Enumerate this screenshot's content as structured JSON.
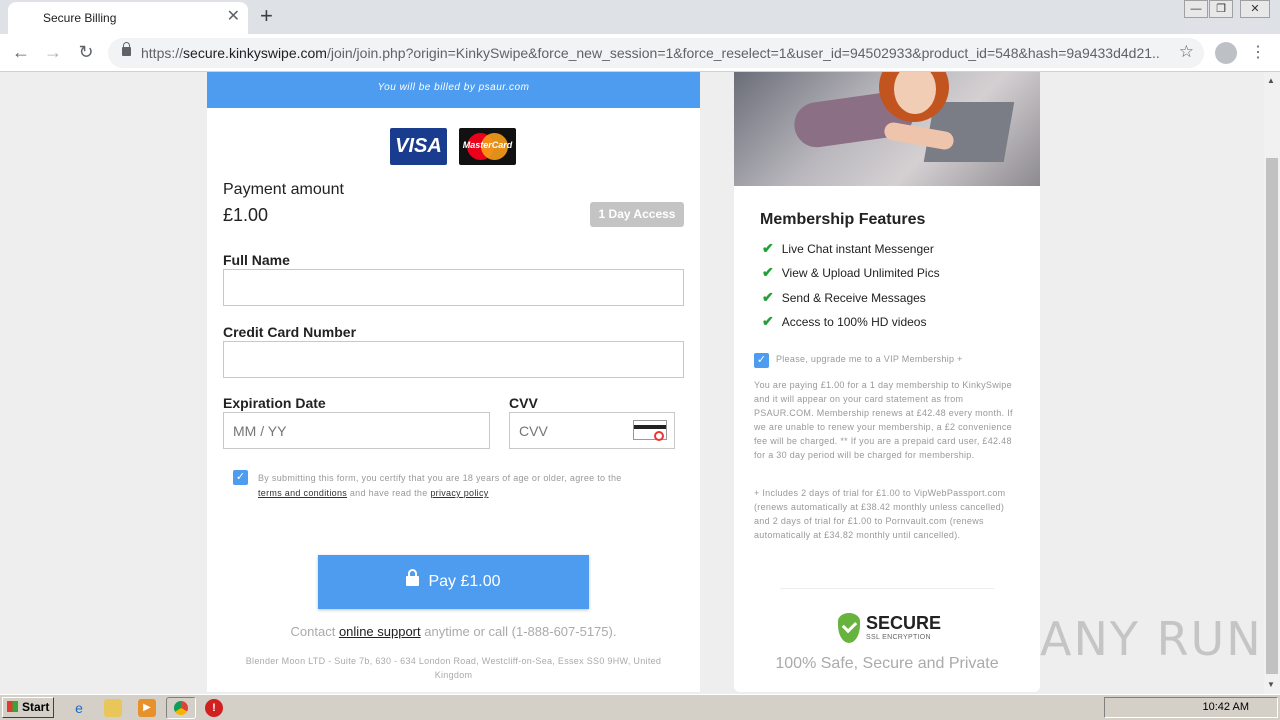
{
  "browser": {
    "tab_title": "Secure Billing",
    "tab_close": "✕",
    "new_tab": "+",
    "url_scheme": "https://",
    "url_host": "secure.kinkyswipe.com",
    "url_path": "/join/join.php?origin=KinkySwipe&force_new_session=1&force_reselect=1&user_id=94502933&product_id=548&hash=9a9433d4d21...",
    "back": "←",
    "forward": "→",
    "reload": "↻",
    "star": "☆",
    "menu": "⋮",
    "min": "—",
    "max": "❐",
    "close": "✕"
  },
  "left": {
    "billed_by": "You will be billed by psaur.com",
    "visa": "VISA",
    "mastercard": "MasterCard",
    "payment_label": "Payment amount",
    "payment_amount": "£1.00",
    "access_badge": "1 Day Access",
    "full_name_label": "Full Name",
    "full_name_value": "",
    "card_label": "Credit Card Number",
    "card_value": "",
    "exp_label": "Expiration Date",
    "exp_placeholder": "MM / YY",
    "cvv_label": "CVV",
    "cvv_placeholder": "CVV",
    "terms_prefix": "By submitting this form, you certify that you are 18 years of age or older, agree to the",
    "terms_link": "terms and conditions",
    "terms_mid": "and have read the",
    "privacy_link": "privacy policy",
    "pay_button": "Pay £1.00",
    "contact_prefix": "Contact",
    "contact_link": "online support",
    "contact_suffix": "anytime or call (1-888-607-5175).",
    "address": "Blender Moon LTD - Suite 7b, 630 - 634 London Road, Westcliff-on-Sea, Essex SS0 9HW, United Kingdom"
  },
  "right": {
    "features_title": "Membership Features",
    "features": [
      "Live Chat instant Messenger",
      "View & Upload Unlimited Pics",
      "Send & Receive Messages",
      "Access to 100% HD videos"
    ],
    "vip_label": "Please, upgrade me to a VIP Membership +",
    "note1": "You are paying £1.00 for a 1 day membership to KinkySwipe and it will appear on your card statement as from PSAUR.COM. Membership renews at £42.48 every month. If we are unable to renew your membership, a £2 convenience fee will be charged. ** If you are a prepaid card user, £42.48 for a 30 day period will be charged for membership.",
    "note2": "+ Includes 2 days of trial for £1.00 to VipWebPassport.com (renews automatically at £38.42 monthly unless cancelled) and 2 days of trial for £1.00 to Pornvault.com (renews automatically at £34.82 monthly until cancelled).",
    "secure_word": "SECURE",
    "ssl": "SSL ENCRYPTION",
    "safe": "100% Safe, Secure and Private"
  },
  "watermark": "ANY RUN",
  "taskbar": {
    "start": "Start",
    "clock": "10:42 AM"
  },
  "colors": {
    "accent_blue": "#4e9cf0",
    "check_green": "#21a038"
  }
}
